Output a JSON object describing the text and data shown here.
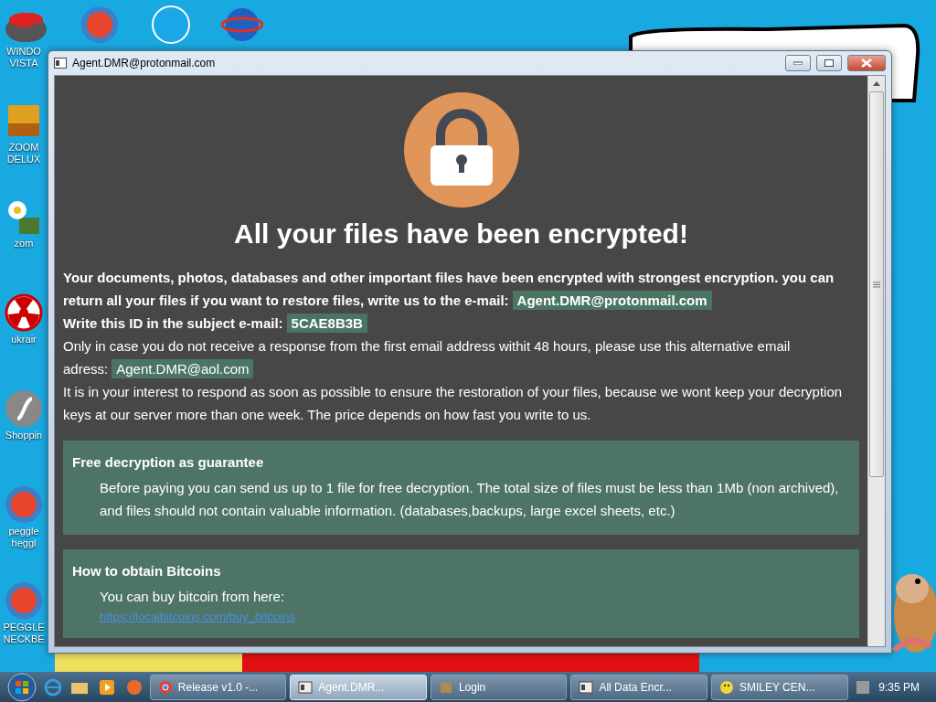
{
  "desktop_icons": [
    {
      "label_lines": [
        "WINDO",
        "VISTA"
      ],
      "kind": "bowl"
    },
    {
      "label_lines": [
        "ZOOM",
        "DELUX"
      ],
      "kind": "blocks"
    },
    {
      "label_lines": [
        "zom"
      ],
      "kind": "flower"
    },
    {
      "label_lines": [
        "ukrair"
      ],
      "kind": "hazard"
    },
    {
      "label_lines": [
        "Shoppin"
      ],
      "kind": "flash"
    },
    {
      "label_lines": [
        "peggle",
        "heggl"
      ],
      "kind": "peggle"
    },
    {
      "label_lines": [
        "PEGGLE",
        "NECKBE"
      ],
      "kind": "peggle"
    }
  ],
  "window": {
    "title": "Agent.DMR@protonmail.com",
    "heading": "All your files have been encrypted!",
    "paragraphs": [
      {
        "bold": true,
        "text": "Your documents, photos, databases and other important files have been encrypted with strongest encryption. you can return all your files if you want to restore files, write us to the e-mail:",
        "highlight": "Agent.DMR@protonmail.com"
      },
      {
        "bold": true,
        "text": "Write this ID in the subject e-mail:",
        "highlight": "5CAE8B3B"
      },
      {
        "bold": false,
        "text": "Only in case you do not receive a response from the first email address withit 48 hours, please use this alternative email adress:",
        "highlight": "Agent.DMR@aol.com"
      },
      {
        "bold": false,
        "text": "It is in your interest to respond as soon as possible to ensure the restoration of your files, because we wont keep your decryption keys at our server more than one week. The price depends on how fast you write to us."
      }
    ],
    "sections": [
      {
        "title": "Free decryption as guarantee",
        "body": "Before paying you can send us up to 1 file for free decryption. The total size of files must be less than 1Mb (non archived), and files should not contain valuable information. (databases,backups, large excel sheets, etc.)"
      },
      {
        "title": "How to obtain Bitcoins",
        "body": "You can buy bitcoin from here:",
        "link": "https://localbitcoins.com/buy_bitcoins"
      }
    ]
  },
  "taskbar": {
    "tasks": [
      {
        "label": "Release v1.0 -...",
        "kind": "browser",
        "selected": false
      },
      {
        "label": "Agent.DMR...",
        "kind": "window",
        "selected": true
      },
      {
        "label": "Login",
        "kind": "app",
        "selected": false
      },
      {
        "label": "All Data Encr...",
        "kind": "window",
        "selected": false
      },
      {
        "label": "SMILEY CEN...",
        "kind": "smiley",
        "selected": false
      }
    ],
    "clock": "9:35 PM"
  }
}
